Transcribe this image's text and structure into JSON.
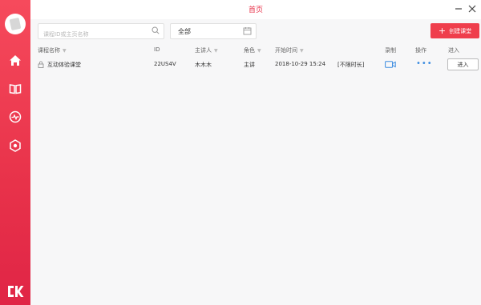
{
  "window": {
    "title": "首页"
  },
  "sidebar": {
    "icons": [
      "avatar",
      "home-icon",
      "book-icon",
      "activity-icon",
      "hexagon-icon"
    ],
    "logo": "CK"
  },
  "toolbar": {
    "search_placeholder": "课程ID或主页名称",
    "filter_value": "全部",
    "create_label": "创建课堂",
    "create_plus": "+"
  },
  "table": {
    "columns": [
      "课程名称",
      "ID",
      "主讲人",
      "角色",
      "开始时间",
      "录制",
      "操作",
      "进入"
    ],
    "rows": [
      {
        "name": "互动体验课堂",
        "id": "22US4V",
        "speaker": "木木木",
        "role": "主讲",
        "start": "2018-10-29 15:24",
        "duration": "[不限时长]",
        "ops": "•••",
        "enter": "进入"
      }
    ]
  },
  "colors": {
    "accent": "#ef3e4c",
    "sidebar_top": "#f64a5c",
    "sidebar_bottom": "#e02546",
    "link": "#3a8be0"
  }
}
